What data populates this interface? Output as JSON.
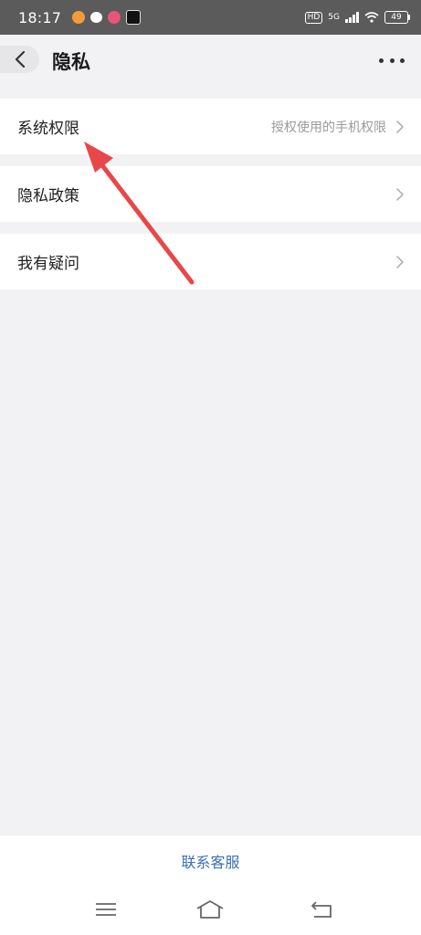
{
  "status_bar": {
    "time": "18:17",
    "network": "5G",
    "hd": "HD",
    "battery": "49",
    "app_icons": [
      "app-notification-icon",
      "chat-bubble-icon",
      "heart-app-icon",
      "tiktok-icon"
    ]
  },
  "nav": {
    "title": "隐私",
    "back_icon": "chevron-left-icon",
    "more_icon": "more-dots-icon"
  },
  "rows": [
    {
      "label": "系统权限",
      "description": "授权使用的手机权限"
    },
    {
      "label": "隐私政策",
      "description": ""
    },
    {
      "label": "我有疑问",
      "description": ""
    }
  ],
  "footer": {
    "link": "联系客服"
  },
  "colors": {
    "accent_link": "#3a6fb4",
    "annotation_arrow": "#e8474a",
    "background": "#f2f2f4"
  }
}
